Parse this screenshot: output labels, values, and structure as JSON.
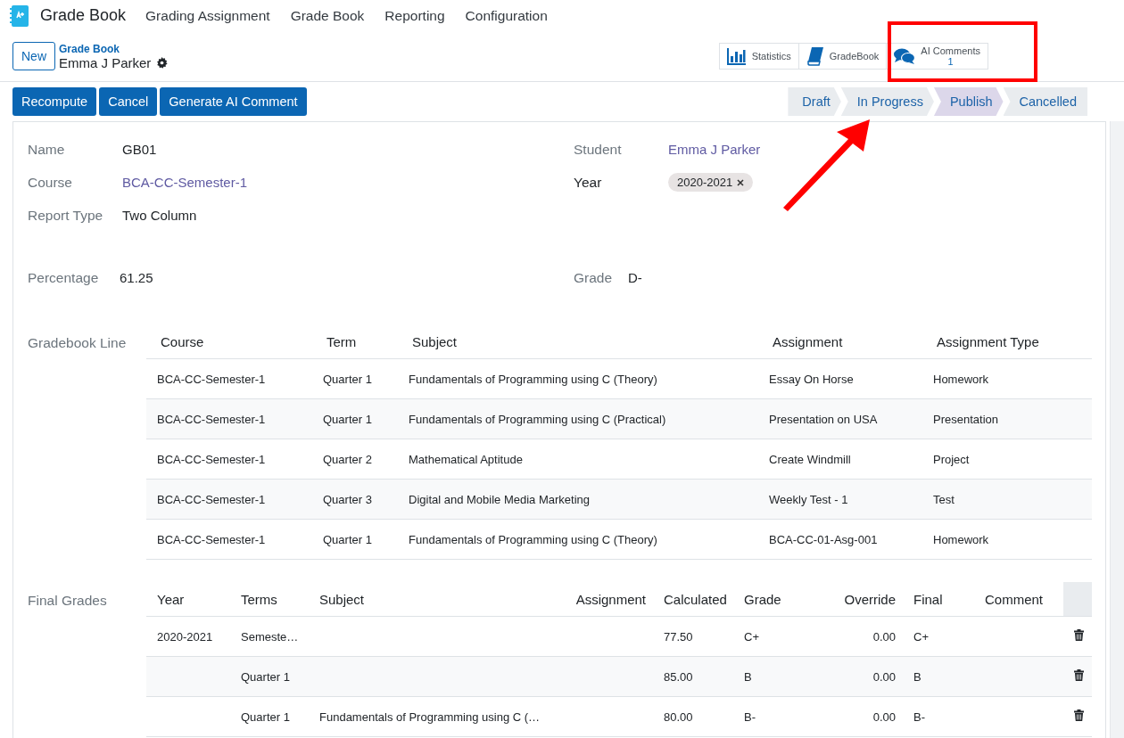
{
  "app": {
    "name": "Grade Book"
  },
  "menu": [
    "Grading Assignment",
    "Grade Book",
    "Reporting",
    "Configuration"
  ],
  "breadcrumb": {
    "new_button": "New",
    "parent": "Grade Book",
    "record": "Emma J Parker"
  },
  "smart_buttons": [
    {
      "kind": "chart",
      "label": "Statistics"
    },
    {
      "kind": "book",
      "label": "GradeBook"
    },
    {
      "kind": "comments",
      "label": "AI Comments",
      "count": "1"
    }
  ],
  "actions": [
    "Recompute",
    "Cancel",
    "Generate AI Comment"
  ],
  "stages": [
    {
      "label": "Draft",
      "selected": false
    },
    {
      "label": "In Progress",
      "selected": false
    },
    {
      "label": "Publish",
      "selected": true
    },
    {
      "label": "Cancelled",
      "selected": false
    }
  ],
  "fields_left": [
    {
      "label": "Name",
      "value": "GB01",
      "kind": "text",
      "required": false
    },
    {
      "label": "Course",
      "value": "BCA-CC-Semester-1",
      "kind": "link",
      "required": false
    },
    {
      "label": "Report Type",
      "value": "Two Column",
      "kind": "text",
      "required": false
    }
  ],
  "fields_right": [
    {
      "label": "Student",
      "value": "Emma J Parker",
      "kind": "link",
      "required": false
    },
    {
      "label": "Year",
      "value": "2020-2021",
      "kind": "tag",
      "required": true
    }
  ],
  "percentage": {
    "label": "Percentage",
    "value": "61.25"
  },
  "grade": {
    "label": "Grade",
    "value": "D-"
  },
  "gradebook_lines": {
    "label": "Gradebook Line",
    "columns": [
      "Course",
      "Term",
      "Subject",
      "Assignment",
      "Assignment Type"
    ],
    "rows": [
      [
        "BCA-CC-Semester-1",
        "Quarter 1",
        "Fundamentals of Programming using C (Theory)",
        "Essay On Horse",
        "Homework"
      ],
      [
        "BCA-CC-Semester-1",
        "Quarter 1",
        "Fundamentals of Programming using C (Practical)",
        "Presentation on USA",
        "Presentation"
      ],
      [
        "BCA-CC-Semester-1",
        "Quarter 2",
        "Mathematical Aptitude",
        "Create Windmill",
        "Project"
      ],
      [
        "BCA-CC-Semester-1",
        "Quarter 3",
        "Digital and Mobile Media Marketing",
        "Weekly Test - 1",
        "Test"
      ],
      [
        "BCA-CC-Semester-1",
        "Quarter 1",
        "Fundamentals of Programming using C (Theory)",
        "BCA-CC-01-Asg-001",
        "Homework"
      ]
    ]
  },
  "final_grades": {
    "label": "Final Grades",
    "columns": [
      "Year",
      "Terms",
      "Subject",
      "Assignment",
      "Calculated",
      "Grade",
      "Override",
      "Final",
      "Comment"
    ],
    "rows": [
      {
        "year": "2020-2021",
        "terms": "Semeste…",
        "calculated": "77.50",
        "grade": "C+",
        "override": "0.00",
        "final": "C+"
      },
      {
        "terms": "Quarter 1",
        "calculated": "85.00",
        "grade": "B",
        "override": "0.00",
        "final": "B"
      },
      {
        "terms": "Quarter 1",
        "subject": "Fundamentals of Programming using C (…",
        "calculated": "80.00",
        "grade": "B-",
        "override": "0.00",
        "final": "B-"
      }
    ]
  }
}
